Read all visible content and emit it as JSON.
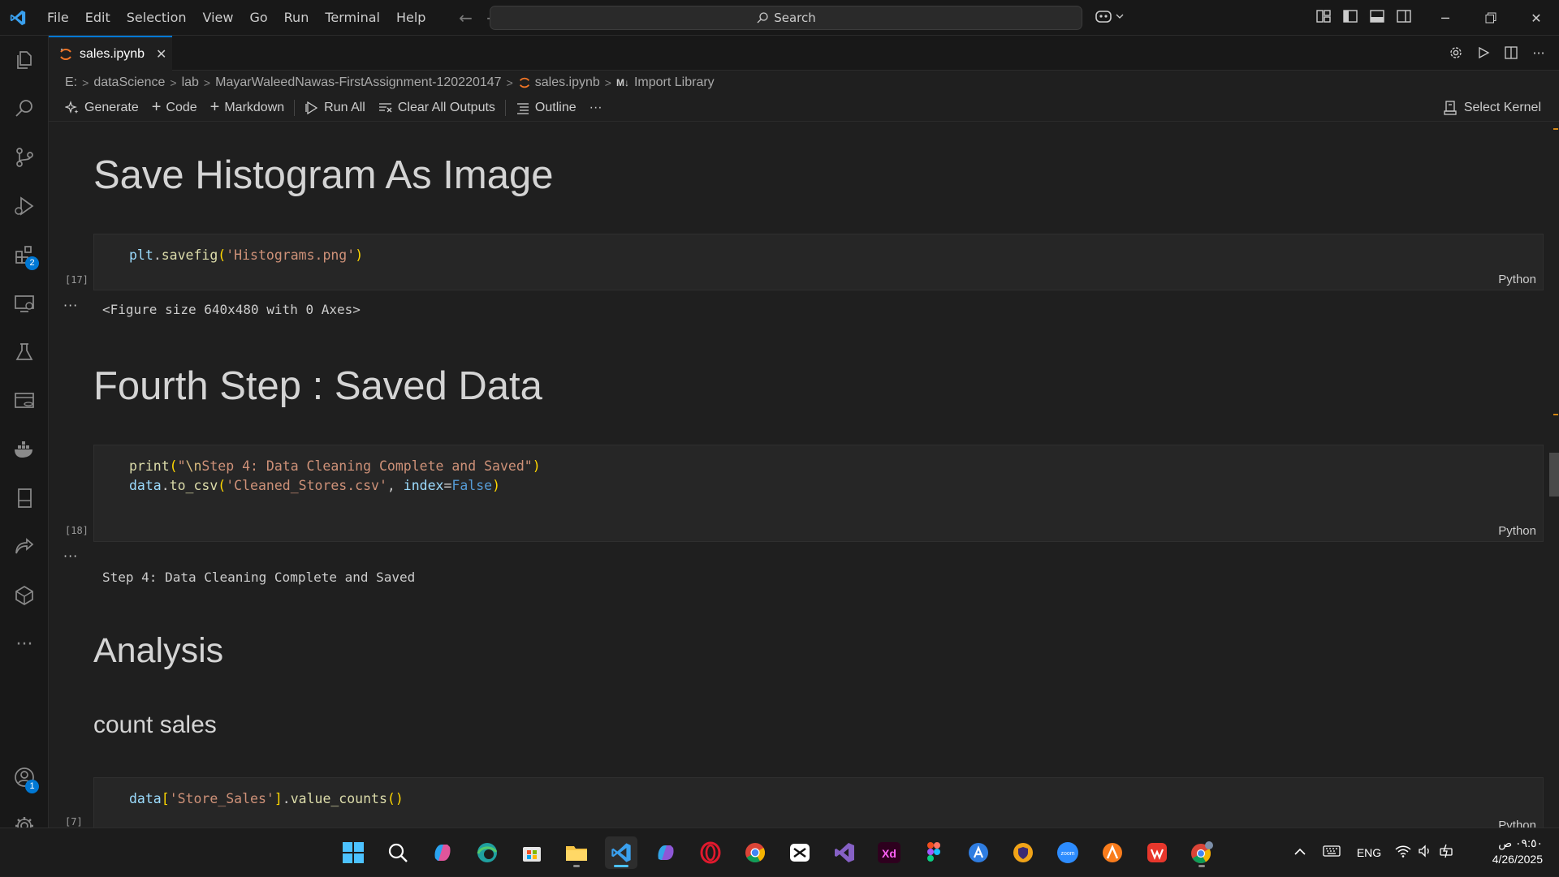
{
  "menu": [
    "File",
    "Edit",
    "Selection",
    "View",
    "Go",
    "Run",
    "Terminal",
    "Help"
  ],
  "search": {
    "label": "Search"
  },
  "activity_badges": {
    "extensions": "2",
    "accounts": "1"
  },
  "tab": {
    "label": "sales.ipynb",
    "close": "✕"
  },
  "breadcrumb": [
    "E:",
    "dataScience",
    "lab",
    "MayarWaleedNawas-FirstAssignment-120220147",
    "sales.ipynb",
    "Import Library"
  ],
  "breadcrumb_md_tag": "M↓",
  "toolbar": {
    "generate": "Generate",
    "code": "Code",
    "markdown": "Markdown",
    "run_all": "Run All",
    "clear": "Clear All Outputs",
    "outline": "Outline",
    "more": "···",
    "kernel": "Select Kernel"
  },
  "notebook": {
    "h1_save": "Save Histogram As Image",
    "cell17": {
      "exec": "[17]",
      "lang": "Python",
      "output": "<Figure size 640x480 with 0 Axes>"
    },
    "h1_fourth": "Fourth Step : Saved Data",
    "cell18": {
      "exec": "[18]",
      "lang": "Python",
      "output": "Step 4: Data Cleaning Complete and Saved"
    },
    "h1_analysis": "Analysis",
    "h2_count": "count sales",
    "cell7": {
      "exec": "[7]",
      "lang": "Python"
    },
    "out_dots": "···"
  },
  "tray": {
    "lang": "ENG",
    "time": "٠٩:٥٠ ص",
    "date": "4/26/2025"
  },
  "colors": {
    "accent": "#0078d4",
    "string": "#ce9178",
    "function": "#dcdcaa",
    "variable": "#9cdcfe",
    "bracket": "#ffd700"
  }
}
